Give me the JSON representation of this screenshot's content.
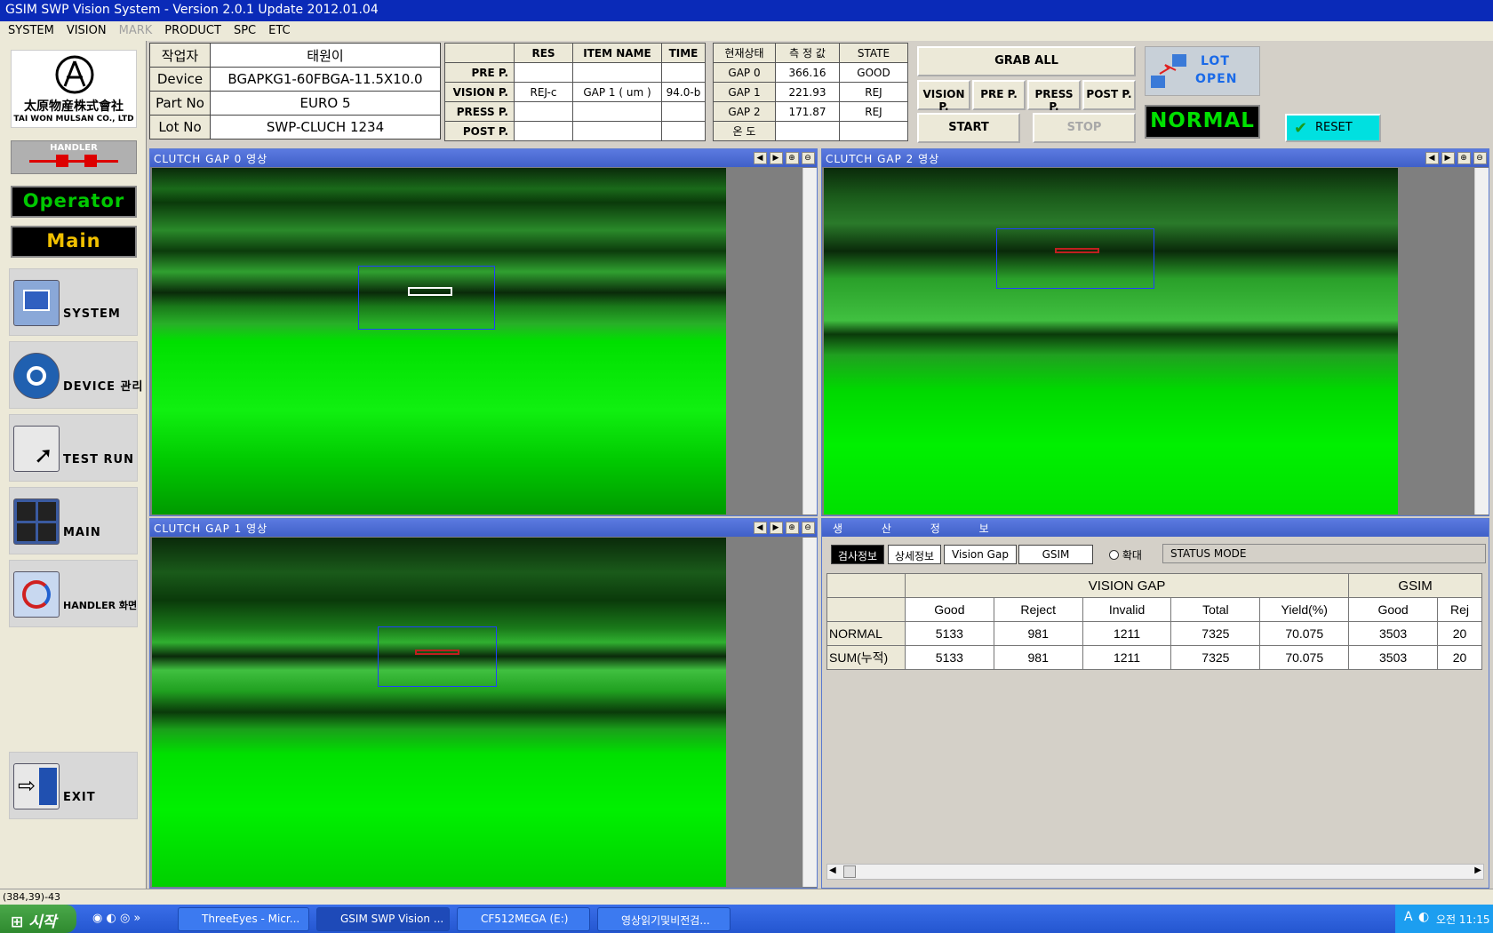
{
  "window": {
    "title": "GSIM SWP Vision System - Version 2.0.1 Update 2012.01.04"
  },
  "menu": [
    "SYSTEM",
    "VISION",
    "MARK",
    "PRODUCT",
    "SPC",
    "ETC"
  ],
  "logo": {
    "name_cn": "太原物産株式會社",
    "name_en": "TAI WON MULSAN CO., LTD"
  },
  "handler_logo": "HANDLER",
  "modes": {
    "operator": "Operator",
    "main": "Main"
  },
  "nav": [
    {
      "label": "SYSTEM",
      "icon": "monitor-gear-icon"
    },
    {
      "label": "DEVICE 관리",
      "icon": "gear-icon"
    },
    {
      "label": "TEST RUN",
      "icon": "cursor-icon"
    },
    {
      "label": "MAIN",
      "icon": "grid-icon"
    },
    {
      "label": "HANDLER 화면",
      "icon": "refresh-icon"
    },
    {
      "label": "EXIT",
      "icon": "exit-icon"
    }
  ],
  "info": [
    {
      "key": "작업자",
      "value": "태원이"
    },
    {
      "key": "Device",
      "value": "BGAPKG1-60FBGA-11.5X10.0"
    },
    {
      "key": "Part No",
      "value": "EURO 5"
    },
    {
      "key": "Lot No",
      "value": "SWP-CLUCH 1234"
    }
  ],
  "process": {
    "headers": [
      "",
      "RES",
      "ITEM NAME",
      "TIME"
    ],
    "rows": [
      {
        "name": "PRE P.",
        "res": "",
        "item": "",
        "time": ""
      },
      {
        "name": "VISION P.",
        "res": "REJ-c",
        "item": "GAP 1 ( um )",
        "time": "94.0-b"
      },
      {
        "name": "PRESS P.",
        "res": "",
        "item": "",
        "time": ""
      },
      {
        "name": "POST P.",
        "res": "",
        "item": "",
        "time": ""
      }
    ]
  },
  "gaps": {
    "headers": [
      "현재상태",
      "측 정 값",
      "STATE"
    ],
    "rows": [
      {
        "name": "GAP 0",
        "value": "366.16",
        "state": "GOOD"
      },
      {
        "name": "GAP 1",
        "value": "221.93",
        "state": "REJ"
      },
      {
        "name": "GAP 2",
        "value": "171.87",
        "state": "REJ"
      },
      {
        "name": "온 도",
        "value": "",
        "state": ""
      }
    ]
  },
  "buttons": {
    "grab_all": "GRAB ALL",
    "vision_p": "VISION P.",
    "pre_p": "PRE P.",
    "press_p": "PRESS P.",
    "post_p": "POST P.",
    "start": "START",
    "stop": "STOP",
    "reset": "RESET"
  },
  "lot": {
    "line1": "LOT",
    "line2": "OPEN"
  },
  "status_indicator": "NORMAL",
  "panels": {
    "gap0": "CLUTCH GAP 0 영상",
    "gap2": "CLUTCH GAP 2 영상",
    "gap1": "CLUTCH GAP 1 영상",
    "production": "생 산 정 보"
  },
  "production": {
    "tabs": [
      "검사정보",
      "상세정보",
      "Vision Gap",
      "GSIM"
    ],
    "zoom_label": "확대",
    "status_mode": "STATUS MODE",
    "group_headers": [
      "VISION GAP",
      "GSIM"
    ],
    "columns": [
      "Good",
      "Reject",
      "Invalid",
      "Total",
      "Yield(%)",
      "Good",
      "Rej"
    ],
    "rows": [
      {
        "label": "NORMAL",
        "values": [
          "5133",
          "981",
          "1211",
          "7325",
          "70.075",
          "3503",
          "20"
        ]
      },
      {
        "label": "SUM(누적)",
        "values": [
          "5133",
          "981",
          "1211",
          "7325",
          "70.075",
          "3503",
          "20"
        ]
      }
    ]
  },
  "statusbar": "(384,39)-43",
  "taskbar": {
    "start": "시작",
    "tasks": [
      "ThreeEyes - Micr...",
      "GSIM SWP Vision ...",
      "CF512MEGA (E:)",
      "영상읽기및비전검..."
    ],
    "clock": "오전 11:15"
  },
  "colors": {
    "title_bar": "#0a2ab8",
    "camera_green": "#00e000",
    "normal_text": "#00e000",
    "operator_text": "#00c800",
    "main_text": "#f0c000",
    "reset_bg": "#00e0e0"
  }
}
